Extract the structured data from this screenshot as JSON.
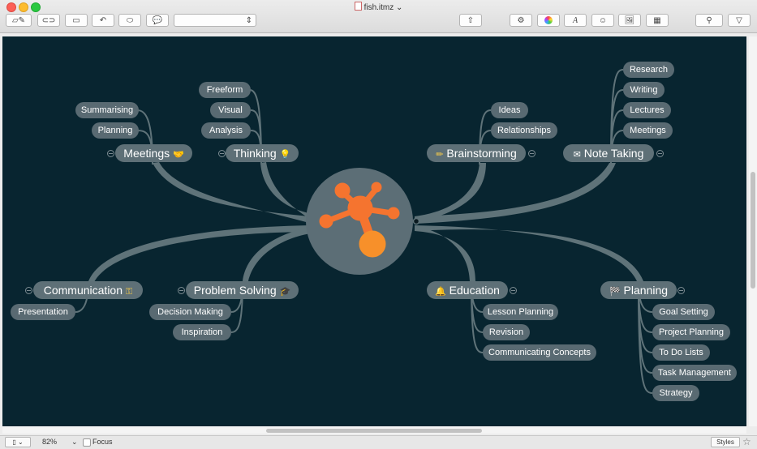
{
  "window": {
    "title": "fish.itmz"
  },
  "toolbar": {
    "style_select_value": ""
  },
  "colors": {
    "canvas": "#082530",
    "node": "#596a72",
    "branch": "#5f7379",
    "logo_orange": "#f5742f"
  },
  "mindmap": {
    "center_icon": "imindmap-logo-icon",
    "branches": {
      "meetings": {
        "label": "Meetings",
        "icon": "handshake-icon",
        "glyph": "🤝",
        "children": [
          "Summarising",
          "Planning"
        ]
      },
      "thinking": {
        "label": "Thinking",
        "icon": "lightbulb-icon",
        "glyph": "💡",
        "children": [
          "Freeform",
          "Visual",
          "Analysis"
        ]
      },
      "brainstorming": {
        "label": "Brainstorming",
        "icon": "pencil-icon",
        "glyph": "✏",
        "children": [
          "Ideas",
          "Relationships"
        ]
      },
      "note_taking": {
        "label": "Note Taking",
        "icon": "envelope-icon",
        "glyph": "✉",
        "children": [
          "Research",
          "Writing",
          "Lectures",
          "Meetings"
        ]
      },
      "communication": {
        "label": "Communication",
        "icon": "key-icon",
        "glyph": "⚿",
        "children": [
          "Presentation"
        ]
      },
      "problem_solving": {
        "label": "Problem Solving",
        "icon": "graduation-cap-icon",
        "glyph": "🎓",
        "children": [
          "Decision Making",
          "Inspiration"
        ]
      },
      "education": {
        "label": "Education",
        "icon": "bell-icon",
        "glyph": "🔔",
        "children": [
          "Lesson Planning",
          "Revision",
          "Communicating Concepts"
        ]
      },
      "planning": {
        "label": "Planning",
        "icon": "checkered-flag-icon",
        "glyph": "🏁",
        "children": [
          "Goal Setting",
          "Project Planning",
          "To Do Lists",
          "Task Management",
          "Strategy"
        ]
      }
    }
  },
  "status": {
    "zoom": "82%",
    "focus_label": "Focus",
    "styles_label": "Styles"
  }
}
